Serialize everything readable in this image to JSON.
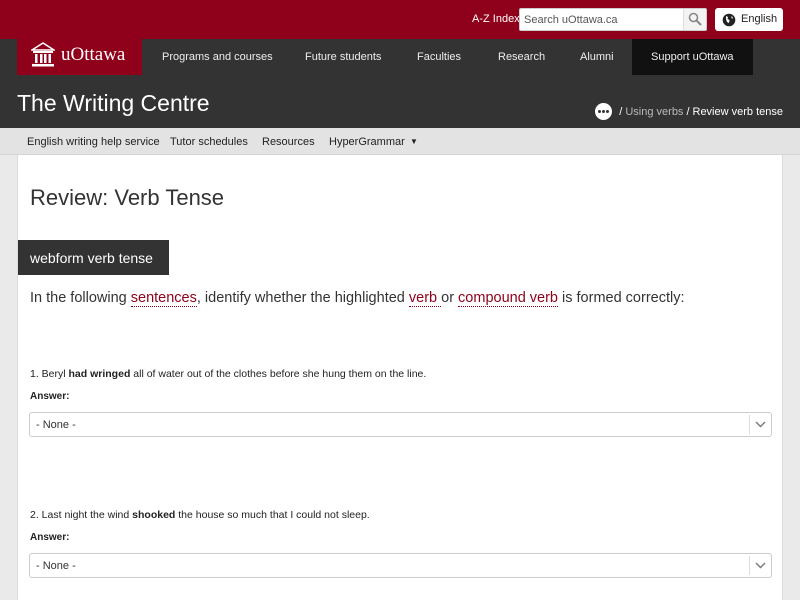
{
  "topbar": {
    "az_index": "A-Z Index",
    "search_placeholder": "Search uOttawa.ca",
    "language": "English"
  },
  "nav": {
    "logo": "uOttawa",
    "items": [
      "Programs and courses",
      "Future students",
      "Faculties",
      "Research",
      "Alumni",
      "Support uOttawa"
    ]
  },
  "site": {
    "title": "The Writing Centre",
    "breadcrumb": {
      "parent": "Using verbs",
      "current": "Review verb tense"
    }
  },
  "subnav": {
    "items": [
      "English writing help service",
      "Tutor schedules",
      "Resources",
      "HyperGrammar"
    ]
  },
  "page": {
    "title": "Review: Verb Tense",
    "form_tag": "webform verb tense",
    "intro": {
      "t1": "In the following ",
      "term1": "sentences",
      "t2": ", identify whether the highlighted ",
      "term2": "verb ",
      "t3": "or ",
      "term3": "compound verb",
      "t4": " is formed correctly:"
    },
    "questions": [
      {
        "before": "1. Beryl ",
        "bold": "had wringed",
        "after": " all of water out of the clothes before she hung them on the line.",
        "answer_label": "Answer:",
        "selected": "- None -"
      },
      {
        "before": "2. Last night the wind ",
        "bold": "shooked",
        "after": " the house so much that I could not sleep.",
        "answer_label": "Answer:",
        "selected": "- None -"
      }
    ]
  },
  "colors": {
    "brand": "#8f001a",
    "dark": "#333333",
    "subnav": "#e3e3e3"
  }
}
